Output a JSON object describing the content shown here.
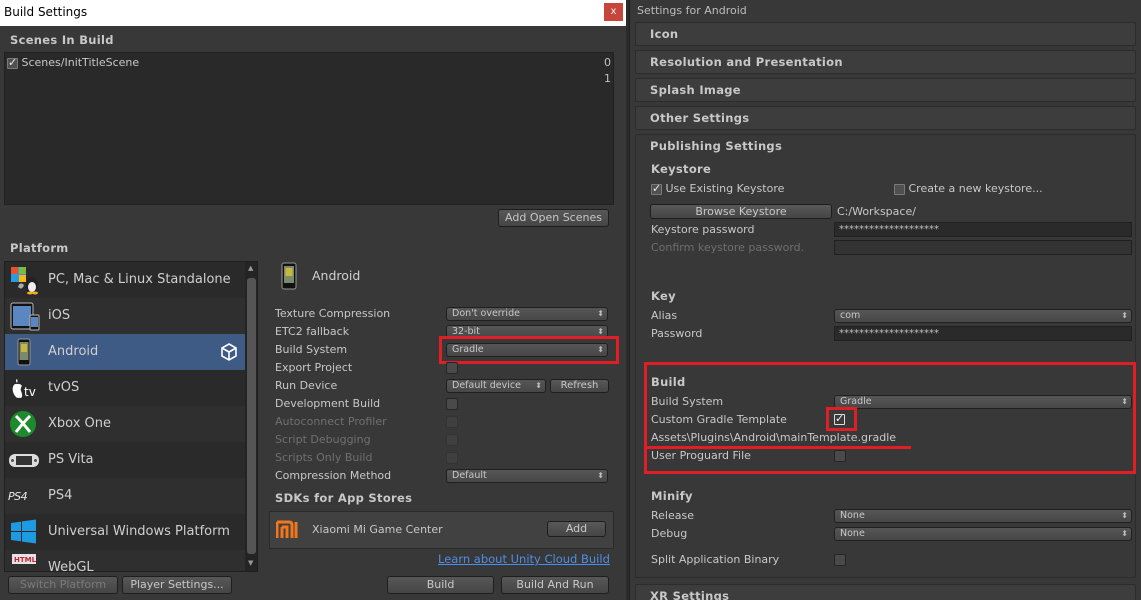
{
  "build_settings": {
    "title": "Build Settings",
    "close_label": "x",
    "scenes_header": "Scenes In Build",
    "scenes": [
      {
        "name": "Scenes/InitTitleScene",
        "index": "0",
        "checked": true
      }
    ],
    "extra_index": "1",
    "add_open_scenes": "Add Open Scenes",
    "platform_header": "Platform",
    "platforms": [
      {
        "label": "PC, Mac & Linux Standalone",
        "icon": "pc-mac-linux-icon"
      },
      {
        "label": "iOS",
        "icon": "ios-icon"
      },
      {
        "label": "Android",
        "icon": "android-icon",
        "selected": true
      },
      {
        "label": "tvOS",
        "icon": "tvos-icon"
      },
      {
        "label": "Xbox One",
        "icon": "xbox-icon"
      },
      {
        "label": "PS Vita",
        "icon": "ps-vita-icon"
      },
      {
        "label": "PS4",
        "icon": "ps4-icon"
      },
      {
        "label": "Universal Windows Platform",
        "icon": "windows-icon"
      },
      {
        "label": "WebGL",
        "icon": "webgl-icon"
      }
    ],
    "selected_platform": "Android",
    "settings": {
      "texture_compression": {
        "label": "Texture Compression",
        "value": "Don't override"
      },
      "etc2_fallback": {
        "label": "ETC2 fallback",
        "value": "32-bit"
      },
      "build_system": {
        "label": "Build System",
        "value": "Gradle"
      },
      "export_project": {
        "label": "Export Project"
      },
      "run_device": {
        "label": "Run Device",
        "value": "Default device",
        "refresh": "Refresh"
      },
      "development_build": {
        "label": "Development Build"
      },
      "autoconnect_profiler": {
        "label": "Autoconnect Profiler"
      },
      "script_debugging": {
        "label": "Script Debugging"
      },
      "scripts_only_build": {
        "label": "Scripts Only Build"
      },
      "compression_method": {
        "label": "Compression Method",
        "value": "Default"
      }
    },
    "sdks_header": "SDKs for App Stores",
    "sdk": {
      "name": "Xiaomi Mi Game Center",
      "add": "Add"
    },
    "learn_link": "Learn about Unity Cloud Build",
    "switch_platform": "Switch Platform",
    "player_settings": "Player Settings...",
    "build": "Build",
    "build_and_run": "Build And Run"
  },
  "player_settings": {
    "title": "Settings for Android",
    "sections": {
      "icon": "Icon",
      "resolution": "Resolution and Presentation",
      "splash": "Splash Image",
      "other": "Other Settings",
      "publishing": "Publishing Settings",
      "xr": "XR Settings"
    },
    "keystore": {
      "header": "Keystore",
      "use_existing": "Use Existing Keystore",
      "create_new": "Create a new keystore...",
      "browse": "Browse Keystore",
      "path": "C:/Workspace/",
      "password_label": "Keystore password",
      "password_value": "********************",
      "confirm_label": "Confirm keystore password."
    },
    "key": {
      "header": "Key",
      "alias_label": "Alias",
      "alias_value": "com",
      "password_label": "Password",
      "password_value": "********************"
    },
    "build": {
      "header": "Build",
      "build_system_label": "Build System",
      "build_system_value": "Gradle",
      "custom_gradle_label": "Custom Gradle Template",
      "custom_gradle_path": "Assets\\Plugins\\Android\\mainTemplate.gradle",
      "proguard_label": "User Proguard File"
    },
    "minify": {
      "header": "Minify",
      "release_label": "Release",
      "release_value": "None",
      "debug_label": "Debug",
      "debug_value": "None"
    },
    "split_binary": "Split Application Binary"
  },
  "colors": {
    "highlight": "#e01e25",
    "selection": "#3e5b85",
    "link": "#4f8ee6"
  }
}
